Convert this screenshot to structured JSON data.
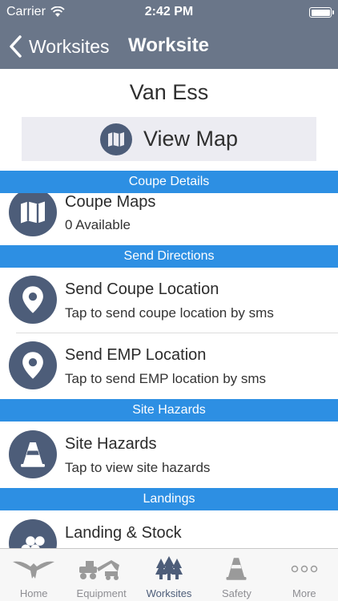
{
  "status_bar": {
    "carrier": "Carrier",
    "time": "2:42 PM"
  },
  "nav": {
    "back_label": "Worksites",
    "title": "Worksite"
  },
  "worksite": {
    "name": "Van Ess",
    "view_map_label": "View Map"
  },
  "sections": {
    "coupe_details": "Coupe Details",
    "send_directions": "Send Directions",
    "site_hazards": "Site Hazards",
    "landings": "Landings"
  },
  "rows": {
    "coupe_maps": {
      "title": "Coupe Maps",
      "subtitle": "0 Available",
      "icon": "map-icon"
    },
    "send_coupe_location": {
      "title": "Send Coupe Location",
      "subtitle": "Tap to send coupe location by sms",
      "icon": "location-pin-icon"
    },
    "send_emp_location": {
      "title": "Send EMP Location",
      "subtitle": "Tap to send EMP location by sms",
      "icon": "location-pin-icon"
    },
    "site_hazards": {
      "title": "Site Hazards",
      "subtitle": "Tap to view site hazards",
      "icon": "traffic-cone-icon"
    },
    "landing_stock": {
      "title": "Landing & Stock",
      "icon": "log-pile-icon"
    }
  },
  "tabs": [
    {
      "label": "Home",
      "icon": "eagle-icon",
      "active": false
    },
    {
      "label": "Equipment",
      "icon": "machinery-icon",
      "active": false
    },
    {
      "label": "Worksites",
      "icon": "trees-icon",
      "active": true
    },
    {
      "label": "Safety",
      "icon": "traffic-cone-icon",
      "active": false
    },
    {
      "label": "More",
      "icon": "more-dots-icon",
      "active": false
    }
  ],
  "colors": {
    "nav_bar": "#6a7689",
    "section_header": "#2d8fe3",
    "icon_circle": "#4d5d79",
    "button_bg": "#ececf2"
  }
}
